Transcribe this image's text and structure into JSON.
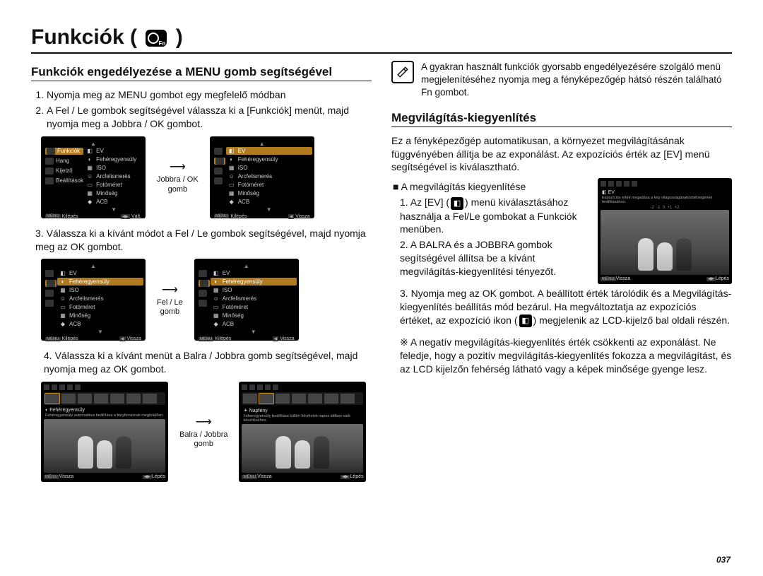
{
  "title": "Funkciók (",
  "title_end": " )",
  "page_number": "037",
  "left": {
    "heading": "Funkciók engedélyezése a MENU gomb segítségével",
    "step1": "Nyomja meg az MENU gombot egy megfelelő módban",
    "step2": "A Fel / Le gombok segítségével válassza ki a [Funkciók] menüt, majd nyomja meg a Jobbra / OK gombot.",
    "step3": "Válassza ki a kívánt módot a Fel / Le gombok segítségével, majd nyomja meg az OK gombot.",
    "step4": "Válassza ki a kívánt menüt a Balra / Jobbra gomb segítségével, majd nyomja meg az OK gombot.",
    "arrow1": "Jobbra / OK\ngomb",
    "arrow2": "Fel / Le\ngomb",
    "arrow3": "Balra / Jobbra\ngomb",
    "cam": {
      "ev": "EV",
      "feher": "Fehéregyensúly",
      "iso": "ISO",
      "arc": "Arcfelismerés",
      "foto": "Fotóméret",
      "minoseg": "Minőség",
      "acb": "ACB",
      "funkciok": "Funkciók",
      "hang": "Hang",
      "kijelzo": "Kijelző",
      "beall": "Beállítások",
      "kilepes": "Kilépés",
      "valt": "Vált.",
      "vissza": "Vissza",
      "lepes": "Lépés",
      "napfeny": "Napfény",
      "desc_feher": "Fehéregyensúly automatikus beállítása a fényforrásnak megfelelően.",
      "desc_nap": "Fehéregyensúly beállítása kültéri felvételek napos időben való készítéséhez."
    }
  },
  "right": {
    "tip": "A gyakran használt funkciók gyorsabb engedélyezésére szolgáló menü megjelenítéséhez nyomja meg a fényképezőgép hátsó részén található Fn gombot.",
    "heading": "Megvilágítás-kiegyenlítés",
    "intro": "Ez a fényképezőgép automatikusan, a környezet megvilágításának függvényében állítja be az exponálást. Az expozíciós érték az [EV] menü segítségével is kiválasztható.",
    "bullet": "A megvilágítás kiegyenlítése",
    "s1_a": "Az [EV] (",
    "s1_b": ") menü kiválasztásához használja a Fel/Le gombokat a Funkciók menüben.",
    "s2": "A BALRA és a JOBBRA gombok segítségével állítsa be a kívánt megvilágítás-kiegyenlítési tényezőt.",
    "s3_a": "Nyomja meg az OK gombot. A beállított érték tárolódik és a Megvilágítás-kiegyenlítés beállítás mód bezárul. Ha megváltoztatja az expozíciós értéket, az expozíció ikon (",
    "s3_b": ") megjelenik az LCD-kijelző bal oldali részén.",
    "note": "※ A negatív megvilágítás-kiegyenlítés érték csökkenti az exponálást. Ne feledje, hogy a pozitív megvilágítás-kiegyenlítés fokozza a megvilágítást, és az LCD kijelzőn fehérség látható vagy a képek minősége gyenge lesz.",
    "cam": {
      "ev": "EV",
      "desc": "Expozíciós érték megadása a kép világosságának/sötétségének beállításához.",
      "vissza": "Vissza",
      "lepes": "Lépés"
    }
  }
}
